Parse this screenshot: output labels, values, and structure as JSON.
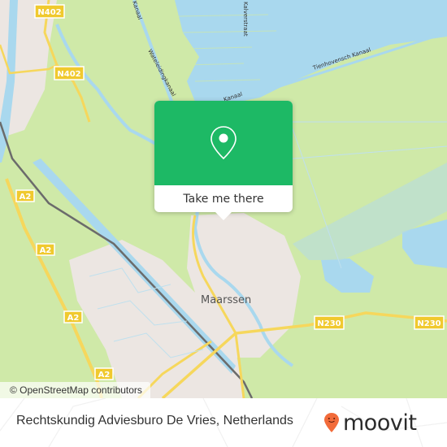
{
  "map": {
    "attribution": "© OpenStreetMap contributors",
    "colors": {
      "land": "#cfe9a8",
      "water": "#a9d8ee",
      "urban": "#ece6e2",
      "road": "#f6d75c",
      "rail": "#6b6b6b"
    },
    "road_shields": [
      "N402",
      "N402",
      "A2",
      "A2",
      "A2",
      "A2",
      "N230",
      "N230"
    ],
    "water_labels": [
      "Kanaal",
      "Wateleidingkanaal",
      "Kalverstraat",
      "Tienhovensch Kanaal",
      "Kanaal"
    ],
    "place_labels": [
      "Maarssen"
    ]
  },
  "popup": {
    "icon": "map-pin-icon",
    "accent_color": "#1db965",
    "button_label": "Take me there"
  },
  "footer": {
    "place_name": "Rechtskundig Adviesburo De Vries, Netherlands",
    "brand": {
      "name": "moovit",
      "logo_icon": "moovit-pin-icon",
      "logo_color": "#f26b3a"
    }
  }
}
